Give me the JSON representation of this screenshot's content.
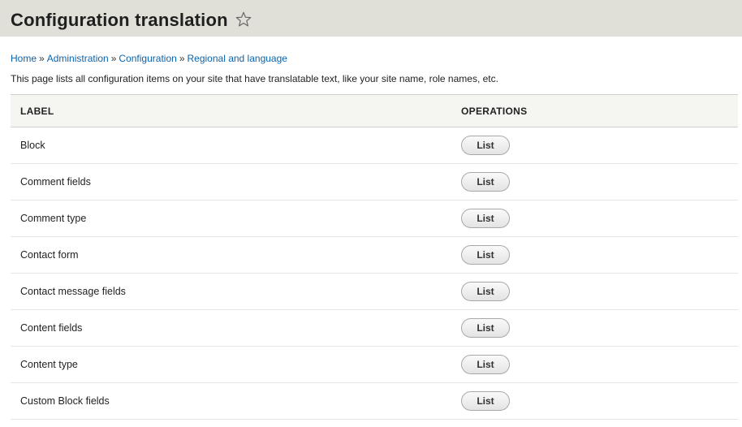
{
  "header": {
    "title": "Configuration translation",
    "star_icon": "star-outline-icon"
  },
  "breadcrumb": {
    "items": [
      "Home",
      "Administration",
      "Configuration",
      "Regional and language"
    ],
    "separator": "»"
  },
  "description": "This page lists all configuration items on your site that have translatable text, like your site name, role names, etc.",
  "table": {
    "headers": {
      "label": "LABEL",
      "operations": "OPERATIONS"
    },
    "rows": [
      {
        "label": "Block",
        "button": "List"
      },
      {
        "label": "Comment fields",
        "button": "List"
      },
      {
        "label": "Comment type",
        "button": "List"
      },
      {
        "label": "Contact form",
        "button": "List"
      },
      {
        "label": "Contact message fields",
        "button": "List"
      },
      {
        "label": "Content fields",
        "button": "List"
      },
      {
        "label": "Content type",
        "button": "List"
      },
      {
        "label": "Custom Block fields",
        "button": "List"
      }
    ]
  },
  "colors": {
    "header_bg": "#e0e0d8",
    "link": "#0a63ad"
  }
}
